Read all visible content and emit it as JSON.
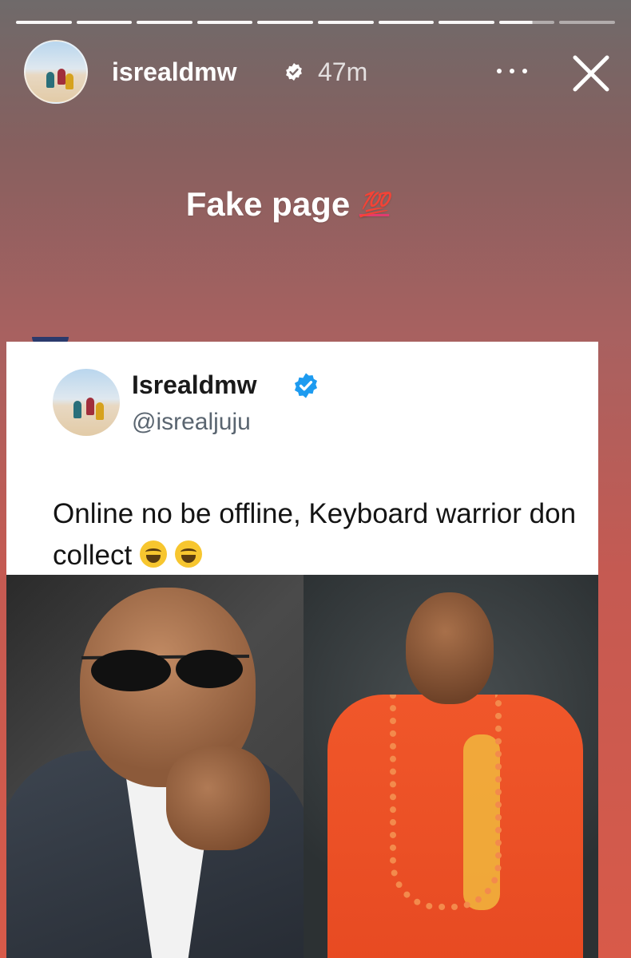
{
  "story": {
    "segments_total": 10,
    "segments_done": 8,
    "username": "isrealdmw",
    "time": "47m",
    "caption": "Fake page",
    "caption_emoji": "💯"
  },
  "tweet": {
    "name": "Isrealdmw",
    "handle": "@isrealjuju",
    "text": "Online no be offline, Keyboard warrior don collect",
    "emoji_count": 2
  },
  "colors": {
    "verified_blue": "#1d9bf0",
    "hundred_red": "#e23b6f"
  },
  "icons": [
    "verified-badge-icon",
    "more-options-icon",
    "close-icon",
    "laughing-emoji-icon"
  ]
}
